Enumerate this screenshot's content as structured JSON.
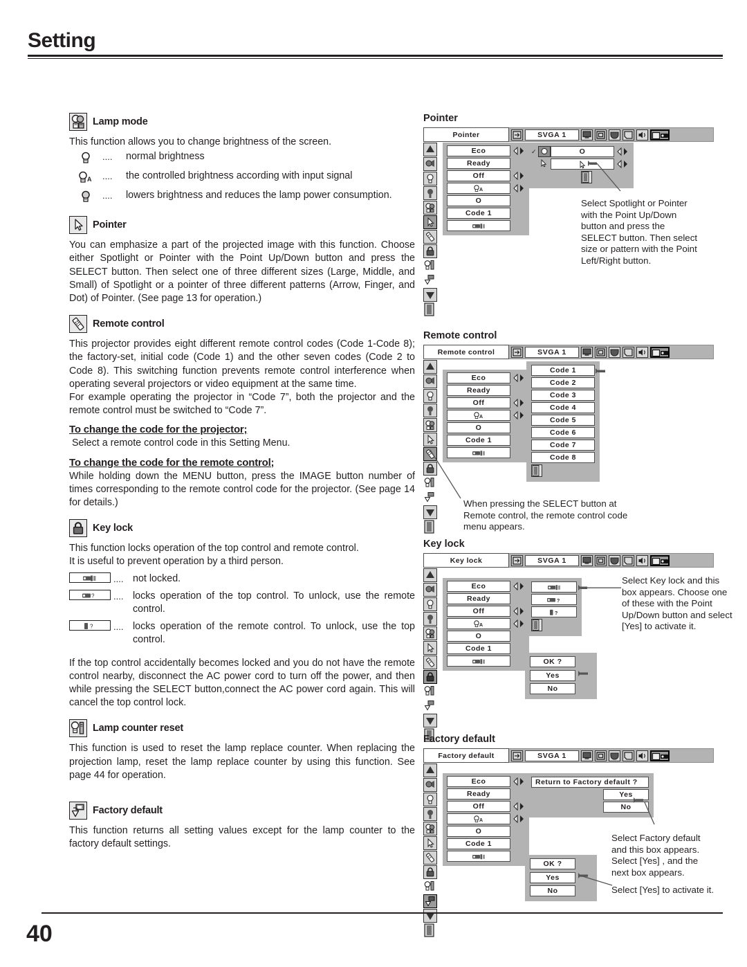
{
  "page": {
    "title": "Setting",
    "number": "40"
  },
  "left": {
    "lamp_mode": {
      "icon": "lamp-mode-icon",
      "heading": "Lamp mode",
      "intro": "This function allows you to change brightness of the screen.",
      "items": [
        {
          "icon": "lamp-normal-icon",
          "dots": "....",
          "text": "normal brightness"
        },
        {
          "icon": "lamp-auto-icon",
          "dots": "....",
          "text": "the controlled brightness according with input signal"
        },
        {
          "icon": "lamp-eco-icon",
          "dots": "....",
          "text": "lowers brightness and reduces the lamp power consumption."
        }
      ]
    },
    "pointer": {
      "icon": "pointer-arrow-icon",
      "heading": "Pointer",
      "body": "You can emphasize a part of the projected image with this function. Choose either Spotlight or Pointer with the Point Up/Down button and press the SELECT button.  Then select one of three different sizes (Large, Middle, and Small) of Spotlight or a pointer of three different patterns (Arrow, Finger, and Dot) of Pointer.  (See page 13 for operation.)"
    },
    "remote_control": {
      "icon": "remote-control-icon",
      "heading": "Remote control",
      "body1": "This projector provides eight different remote control codes (Code 1-Code 8); the factory-set, initial code (Code 1) and the other seven codes (Code 2 to Code 8).  This switching function prevents remote control interference when operating several projectors or video equipment at the same time.",
      "body2": "For example operating the projector in “Code 7”,  both the projector and the remote control must be switched to “Code 7”.",
      "sub1_heading": "To change the code for the projector;",
      "sub1_body": "Select a remote control code in this Setting Menu.",
      "sub2_heading": "To change the code for the remote control;",
      "sub2_body": "While holding down the MENU button, press the IMAGE button number of times corresponding to the remote control code for the projector.  (See page 14 for details.)"
    },
    "key_lock": {
      "icon": "padlock-icon",
      "heading": "Key lock",
      "body1": "This function locks operation of the top control and remote control.",
      "body2": "It is useful to prevent operation by a third person.",
      "items": [
        {
          "icon": "keylock-unlocked-icon",
          "dots": "....",
          "text": "not locked."
        },
        {
          "icon": "keylock-projector-icon",
          "dots": "....",
          "text": "locks operation of the top control.  To unlock, use the remote control."
        },
        {
          "icon": "keylock-remote-icon",
          "dots": "....",
          "text": "locks operation of the remote control.  To unlock, use the top control."
        }
      ],
      "note": "If the top control accidentally becomes locked and you do not have the remote control nearby, disconnect the AC power cord to turn off the power, and then while pressing the SELECT button,connect the AC power cord again.  This will cancel the top control lock."
    },
    "lamp_counter_reset": {
      "icon": "lamp-counter-reset-icon",
      "heading": "Lamp counter reset",
      "body": "This function is used to reset the lamp replace counter.  When replacing the projection lamp, reset the lamp replace counter by using this function.  See page 44 for operation."
    },
    "factory_default": {
      "icon": "factory-default-icon",
      "heading": "Factory default",
      "body": "This function returns all setting values except for the lamp counter to the factory default settings."
    }
  },
  "right": {
    "common": {
      "source": "SVGA 1",
      "menu_values": [
        "Eco",
        "Ready",
        "Off",
        "",
        "O",
        "Code 1",
        ""
      ],
      "row4_icon": "lamp-auto-icon",
      "row7_icon": "keylock-unlocked-icon"
    },
    "pointer": {
      "title": "Pointer",
      "osd_name": "Pointer",
      "submenu": [
        {
          "icon": "spotlight-icon",
          "value": "O",
          "checked": true
        },
        {
          "icon": "pointer-arrow-icon",
          "value": "",
          "checked": false
        }
      ],
      "note": "Select Spotlight or Pointer with the Point Up/Down button and press the SELECT button.  Then select size or pattern with the Point Left/Right button."
    },
    "remote_control": {
      "title": "Remote control",
      "osd_name": "Remote control",
      "codes": [
        "Code 1",
        "Code 2",
        "Code 3",
        "Code 4",
        "Code 5",
        "Code 6",
        "Code 7",
        "Code 8"
      ],
      "note": "When pressing the SELECT button at Remote control, the remote control code menu appears."
    },
    "key_lock": {
      "title": "Key lock",
      "osd_name": "Key lock",
      "options": [
        "keylock-unlocked-icon",
        "keylock-projector-icon",
        "keylock-remote-icon"
      ],
      "confirm": {
        "prompt": "OK ?",
        "yes": "Yes",
        "no": "No"
      },
      "note": "Select Key lock and this box appears. Choose one of these with the Point Up/Down button and select [Yes] to activate it."
    },
    "factory_default": {
      "title": "Factory default",
      "osd_name": "Factory default",
      "prompt": "Return to Factory default ?",
      "yes": "Yes",
      "no": "No",
      "confirm": {
        "prompt": "OK ?",
        "yes": "Yes",
        "no": "No"
      },
      "note1": "Select Factory default and this box appears.  Select [Yes] , and the next box appears.",
      "note2": "Select [Yes] to activate it."
    }
  }
}
